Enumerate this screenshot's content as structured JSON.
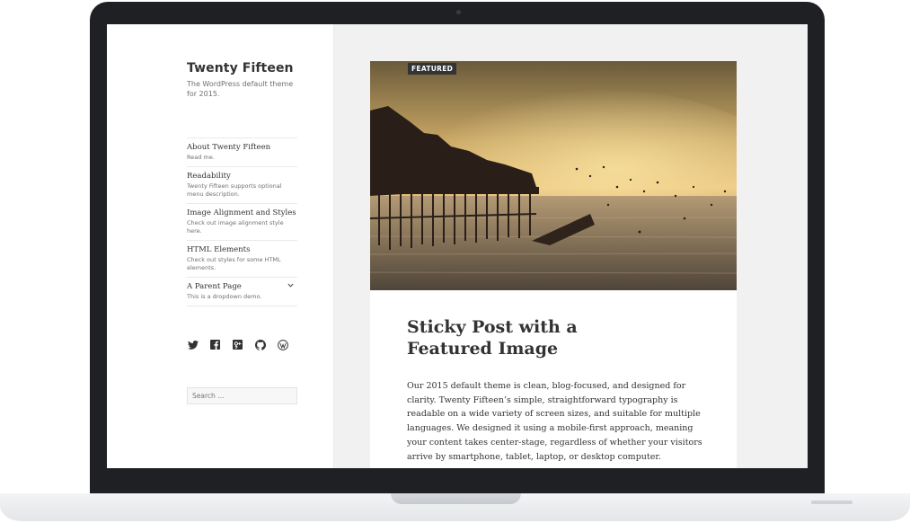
{
  "site": {
    "title": "Twenty Fifteen",
    "description": "The WordPress default theme for 2015."
  },
  "menu": {
    "items": [
      {
        "title": "About Twenty Fifteen",
        "desc": "Read me."
      },
      {
        "title": "Readability",
        "desc": "Twenty Fifteen supports optional menu description."
      },
      {
        "title": "Image Alignment and Styles",
        "desc": "Check out image alignment style here."
      },
      {
        "title": "HTML Elements",
        "desc": "Check out styles for some HTML elements."
      },
      {
        "title": "A Parent Page",
        "desc": "This is a dropdown demo."
      }
    ],
    "chevron": "⌄"
  },
  "social": [
    "twitter-icon",
    "facebook-icon",
    "google-plus-icon",
    "github-icon",
    "wordpress-icon"
  ],
  "search": {
    "placeholder": "Search …"
  },
  "post": {
    "badge": "FEATURED",
    "title": "Sticky Post with a Featured Image",
    "body": "Our 2015 default theme is clean, blog-focused, and designed for clarity. Twenty Fifteen’s simple, straightforward typography is readable on a wide variety of screen sizes, and suitable for multiple languages. We designed it using a mobile-first approach, meaning your content takes center-stage, regardless of whether your visitors arrive by smartphone, tablet, laptop, or desktop computer."
  },
  "colors": {
    "frame": "#1f2023",
    "page_bg": "#f1f1f1",
    "text": "#333333",
    "muted": "#707070"
  }
}
